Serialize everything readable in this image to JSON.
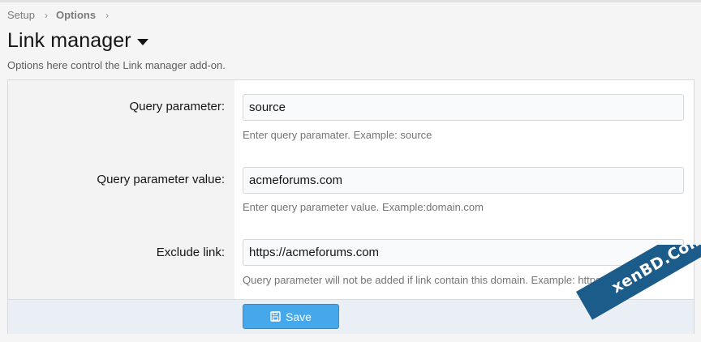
{
  "breadcrumb": {
    "items": [
      "Setup",
      "Options"
    ],
    "separator": "›"
  },
  "page": {
    "title": "Link manager",
    "description": "Options here control the Link manager add-on."
  },
  "form": {
    "fields": [
      {
        "label": "Query parameter:",
        "value": "source",
        "hint": "Enter query paramater. Example: source"
      },
      {
        "label": "Query parameter value:",
        "value": "acmeforums.com",
        "hint": "Enter query parameter value. Example:domain.com"
      },
      {
        "label": "Exclude link:",
        "value": "https://acmeforums.com",
        "hint": "Query parameter will not be added if link contain this domain. Example: https://domain"
      }
    ],
    "save_label": "Save"
  },
  "watermark": {
    "text": "xenBD.Com"
  },
  "colors": {
    "accent": "#47a7eb",
    "footer": "#e9eff4",
    "watermark": "#1c5c8a"
  },
  "icons": {
    "save": "floppy-disk-icon",
    "title_menu": "caret-down-icon",
    "breadcrumb_sep": "chevron-right-icon"
  }
}
